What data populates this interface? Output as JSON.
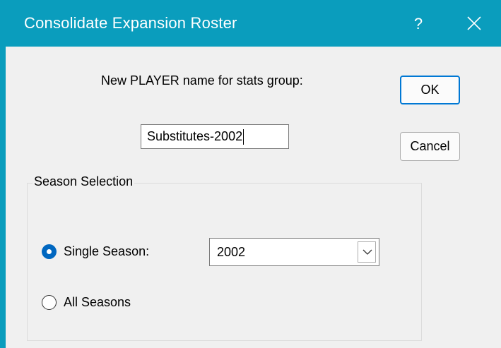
{
  "window": {
    "title": "Consolidate Expansion Roster",
    "help_label": "?"
  },
  "prompt": {
    "label": "New PLAYER name for stats group:"
  },
  "name_field": {
    "value": "Substitutes-2002"
  },
  "buttons": {
    "ok_label": "OK",
    "cancel_label": "Cancel"
  },
  "season_group": {
    "label": "Season Selection",
    "single_label": "Single Season:",
    "all_label": "All Seasons",
    "selected": "single",
    "season_value": "2002"
  },
  "colors": {
    "titlebar": "#0a9dbd",
    "accent": "#0067c0"
  }
}
